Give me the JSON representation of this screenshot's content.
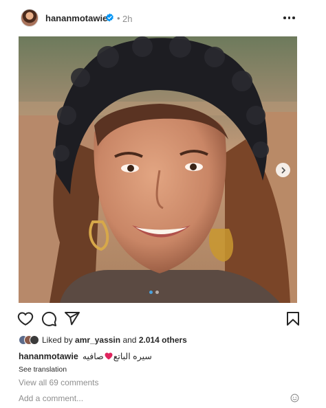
{
  "post": {
    "username": "hananmotawie",
    "separator": "•",
    "time": "2h"
  },
  "icons": {
    "header": [
      "avatar",
      "verified-badge-icon",
      "more-options-icon"
    ],
    "media": [
      "next-arrow-icon",
      "carousel-dots"
    ],
    "actions": [
      "heart-icon",
      "comment-icon",
      "share-icon",
      "bookmark-icon"
    ],
    "footer": [
      "emoji-icon"
    ]
  },
  "carousel": {
    "slides": 2,
    "active": 1
  },
  "likes": {
    "prefix": "Liked by",
    "user": "amr_yassin",
    "joiner": "and",
    "others": "2.014 others"
  },
  "caption": {
    "username": "hananmotawie",
    "text_start": "صافيه",
    "text_end": "سيره الباتع"
  },
  "see_translation": "See translation",
  "view_comments": "View all 69 comments",
  "add_comment_placeholder": "Add a comment...",
  "colors": {
    "text": "#262626",
    "secondary": "#8e8e8e",
    "verified": "#0095f6",
    "heart_emoji": "#e0245e"
  }
}
